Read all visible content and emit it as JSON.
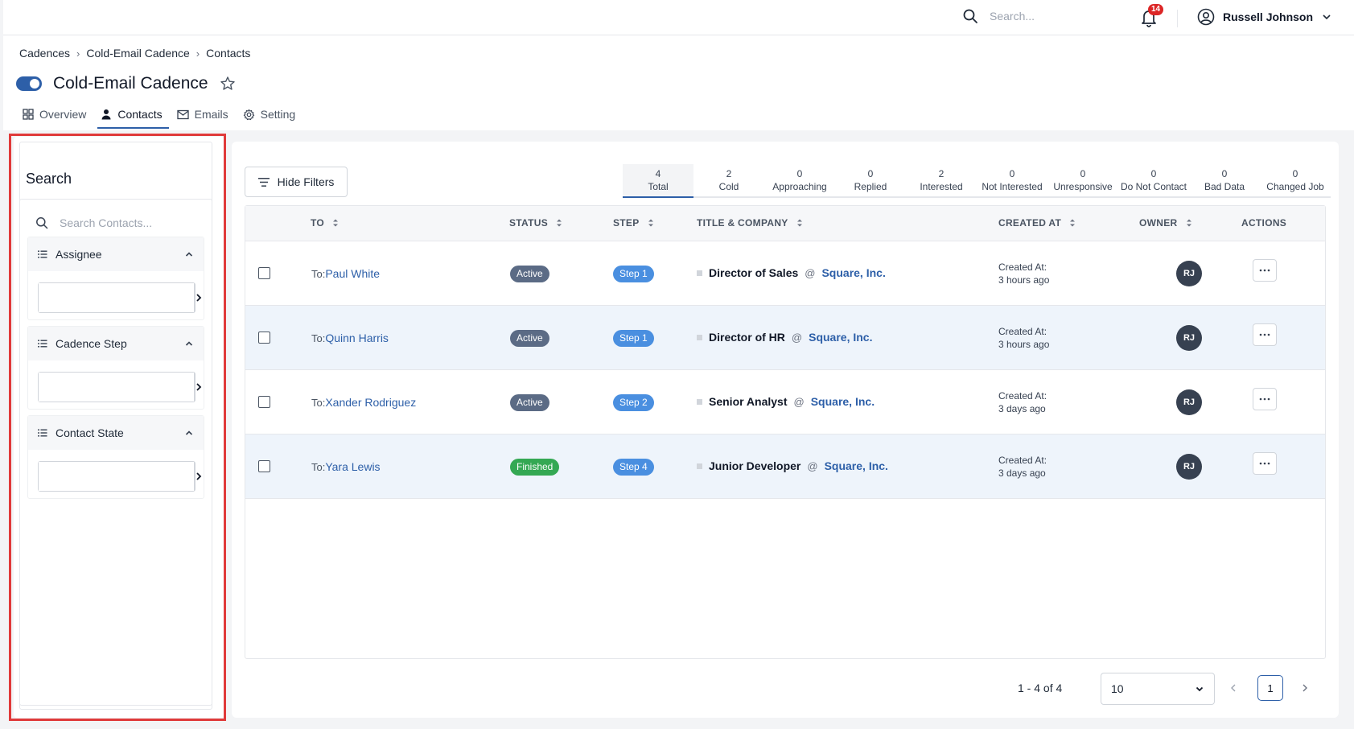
{
  "topbar": {
    "search_placeholder": "Search...",
    "notification_count": "14",
    "user_name": "Russell Johnson"
  },
  "breadcrumb": [
    "Cadences",
    "Cold-Email Cadence",
    "Contacts"
  ],
  "page": {
    "title": "Cold-Email Cadence",
    "toggle_on": true
  },
  "tabs": [
    {
      "label": "Overview",
      "icon": "grid-icon"
    },
    {
      "label": "Contacts",
      "icon": "person-icon",
      "active": true
    },
    {
      "label": "Emails",
      "icon": "mail-icon"
    },
    {
      "label": "Setting",
      "icon": "gear-icon"
    }
  ],
  "filters": {
    "heading": "Search",
    "contact_search_placeholder": "Search Contacts...",
    "groups": [
      {
        "label": "Assignee",
        "value": ""
      },
      {
        "label": "Cadence Step",
        "value": ""
      },
      {
        "label": "Contact State",
        "value": ""
      }
    ]
  },
  "toolbar": {
    "hide_filters_label": "Hide Filters"
  },
  "stats": [
    {
      "count": "4",
      "label": "Total",
      "active": true
    },
    {
      "count": "2",
      "label": "Cold"
    },
    {
      "count": "0",
      "label": "Approaching"
    },
    {
      "count": "0",
      "label": "Replied"
    },
    {
      "count": "2",
      "label": "Interested"
    },
    {
      "count": "0",
      "label": "Not Interested"
    },
    {
      "count": "0",
      "label": "Unresponsive"
    },
    {
      "count": "0",
      "label": "Do Not Contact"
    },
    {
      "count": "0",
      "label": "Bad Data"
    },
    {
      "count": "0",
      "label": "Changed Job"
    }
  ],
  "table": {
    "columns": {
      "to": "TO",
      "status": "STATUS",
      "step": "STEP",
      "title_company": "TITLE & COMPANY",
      "created_at": "CREATED AT",
      "owner": "OWNER",
      "actions": "ACTIONS"
    },
    "rows": [
      {
        "to_prefix": "To:",
        "name": "Paul White",
        "status": "Active",
        "step": "Step 1",
        "title": "Director of Sales",
        "at": "@",
        "company": "Square, Inc.",
        "created_label": "Created At:",
        "created": "3 hours ago",
        "owner": "RJ"
      },
      {
        "to_prefix": "To:",
        "name": "Quinn Harris",
        "status": "Active",
        "step": "Step 1",
        "title": "Director of HR",
        "at": "@",
        "company": "Square, Inc.",
        "created_label": "Created At:",
        "created": "3 hours ago",
        "owner": "RJ"
      },
      {
        "to_prefix": "To:",
        "name": "Xander Rodriguez",
        "status": "Active",
        "step": "Step 2",
        "title": "Senior Analyst",
        "at": "@",
        "company": "Square, Inc.",
        "created_label": "Created At:",
        "created": "3 days ago",
        "owner": "RJ"
      },
      {
        "to_prefix": "To:",
        "name": "Yara Lewis",
        "status": "Finished",
        "step": "Step 4",
        "title": "Junior Developer",
        "at": "@",
        "company": "Square, Inc.",
        "created_label": "Created At:",
        "created": "3 days ago",
        "owner": "RJ"
      }
    ]
  },
  "pagination": {
    "range": "1 - 4 of 4",
    "page_size": "10",
    "current_page": "1"
  },
  "colors": {
    "accent": "#2d5fa8",
    "active_badge": "#5b6b85",
    "finished_badge": "#34a853",
    "step_badge": "#4a8fe0",
    "highlight": "#e03a3a"
  }
}
